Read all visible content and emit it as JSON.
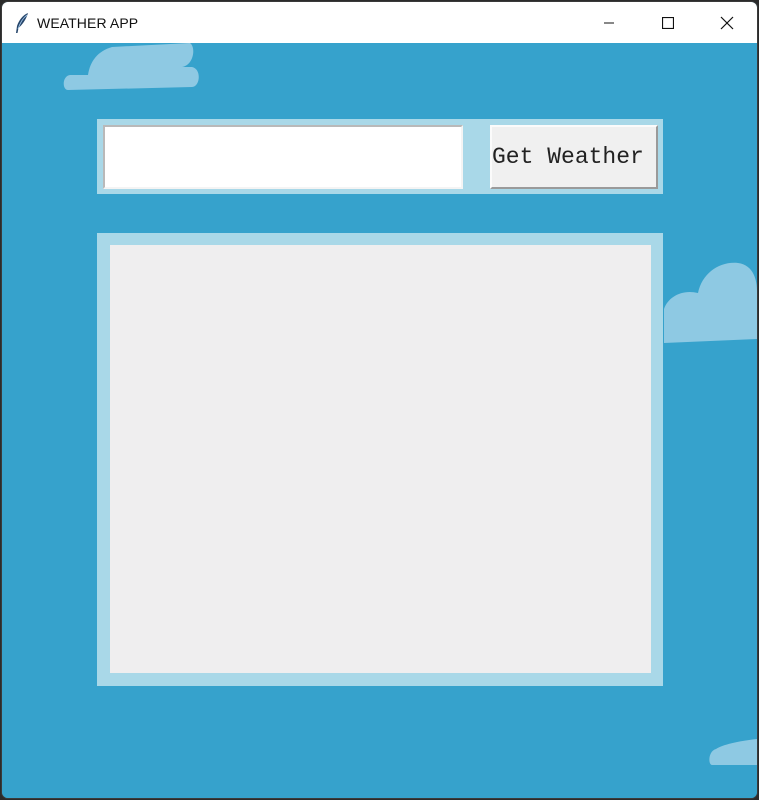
{
  "window": {
    "title": "WEATHER APP"
  },
  "titlebar": {
    "app_icon": "feather-icon",
    "minimize_icon": "minimize-icon",
    "maximize_icon": "maximize-icon",
    "close_icon": "close-icon"
  },
  "search": {
    "city_value": "",
    "button_label": "Get Weather"
  },
  "results": {
    "text": ""
  },
  "colors": {
    "sky": "#36a2cc",
    "panel": "#a9d8e8",
    "cloud": "#8ec9e3",
    "results_bg": "#efeeef"
  }
}
